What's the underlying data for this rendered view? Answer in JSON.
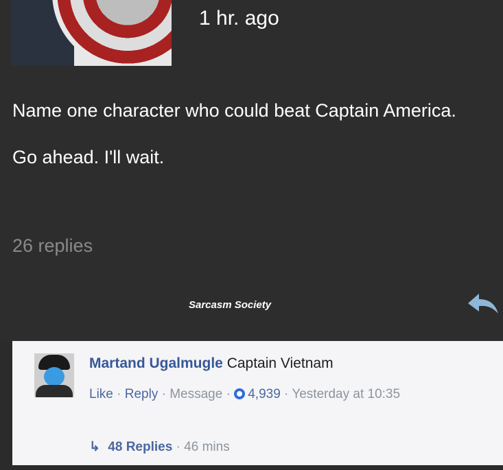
{
  "post": {
    "time": "1 hr. ago",
    "line1": "Name one character who could beat Captain America.",
    "line2": "Go ahead. I'll wait.",
    "replies": "26 replies",
    "watermark": "Sarcasm Society"
  },
  "comment": {
    "author": "Martand Ugalmugle",
    "text": "Captain Vietnam",
    "like": "Like",
    "reply": "Reply",
    "message": "Message",
    "reactions": "4,939",
    "timestamp": "Yesterday at 10:35",
    "replies_label": "48 Replies",
    "replies_time": "46 mins"
  },
  "colors": {
    "dark_bg": "#2d2d2d",
    "light_bg": "#f5f5f7",
    "link": "#365899"
  }
}
